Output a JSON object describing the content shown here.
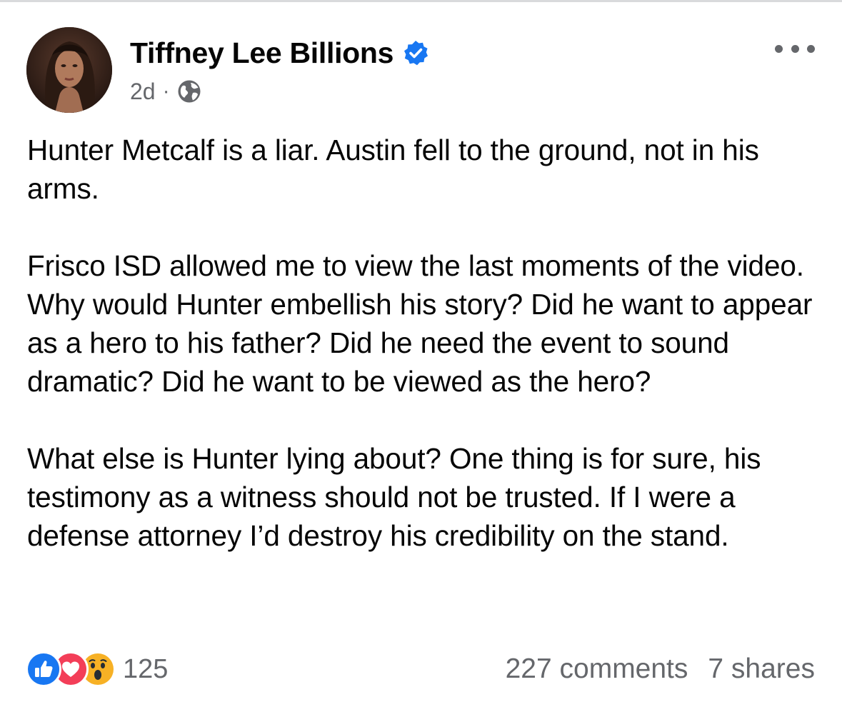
{
  "post": {
    "author_name": "Tiffney Lee Billions",
    "verified": true,
    "timestamp": "2d",
    "separator": "·",
    "audience_icon": "globe-icon",
    "paragraphs": [
      "Hunter Metcalf is a liar. Austin fell to the ground, not in his arms.",
      "Frisco ISD allowed me to view the last moments of the video.  Why would Hunter embellish his story? Did he want to appear as a hero to his father? Did he need the event to sound dramatic? Did he want to be viewed as the hero?",
      "What else is Hunter lying about? One thing is for sure, his testimony as a witness should not be trusted. If I were a defense attorney I’d destroy his credibility on the stand."
    ]
  },
  "reactions": {
    "icons": [
      "like-icon",
      "love-icon",
      "wow-icon"
    ],
    "count": "125"
  },
  "engagement": {
    "comments": "227 comments",
    "shares": "7 shares"
  },
  "colors": {
    "verified_blue": "#1877f2",
    "like_blue": "#1877f2",
    "love_red": "#f33e58",
    "wow_yellow": "#f7b125",
    "secondary_text": "#65676b"
  }
}
